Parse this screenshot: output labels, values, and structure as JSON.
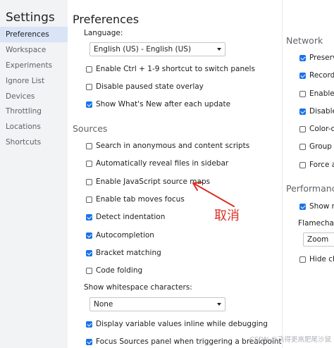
{
  "sidebar": {
    "title": "Settings",
    "items": [
      "Preferences",
      "Workspace",
      "Experiments",
      "Ignore List",
      "Devices",
      "Throttling",
      "Locations",
      "Shortcuts"
    ],
    "selected_index": 0
  },
  "main": {
    "title": "Preferences",
    "appearance": {
      "language_label": "Language:",
      "language_value": "English (US) - English (US)",
      "options": [
        {
          "label": "Enable Ctrl + 1-9 shortcut to switch panels",
          "checked": false
        },
        {
          "label": "Disable paused state overlay",
          "checked": false
        },
        {
          "label": "Show What's New after each update",
          "checked": true
        }
      ]
    },
    "sources": {
      "heading": "Sources",
      "options": [
        {
          "label": "Search in anonymous and content scripts",
          "checked": false
        },
        {
          "label": "Automatically reveal files in sidebar",
          "checked": false
        },
        {
          "label": "Enable JavaScript source maps",
          "checked": false
        },
        {
          "label": "Enable tab moves focus",
          "checked": false
        },
        {
          "label": "Detect indentation",
          "checked": true
        },
        {
          "label": "Autocompletion",
          "checked": true
        },
        {
          "label": "Bracket matching",
          "checked": true
        },
        {
          "label": "Code folding",
          "checked": false
        }
      ],
      "whitespace_label": "Show whitespace characters:",
      "whitespace_value": "None",
      "bottom_options": [
        {
          "label": "Display variable values inline while debugging",
          "checked": true
        },
        {
          "label": "Focus Sources panel when triggering a breakpoint",
          "checked": true
        }
      ]
    }
  },
  "right": {
    "network": {
      "heading": "Network",
      "options": [
        {
          "label": "Preserve",
          "checked": true
        },
        {
          "label": "Record",
          "checked": true
        },
        {
          "label": "Enable n",
          "checked": false
        },
        {
          "label": "Disable",
          "checked": true
        },
        {
          "label": "Color-co",
          "checked": false
        },
        {
          "label": "Group r",
          "checked": false
        },
        {
          "label": "Force ad",
          "checked": false
        }
      ]
    },
    "performance": {
      "heading": "Performance",
      "option": {
        "label": "Show na",
        "checked": true
      },
      "flamechart_label": "Flamechart",
      "flamechart_value": "Zoom",
      "hide_option": {
        "label": "Hide ch",
        "checked": false
      }
    }
  },
  "annotation": {
    "text": "取消",
    "color": "#d93025"
  },
  "watermark": "CSDN @飞得更高肥尾沙鼠",
  "colors": {
    "accent": "#1a73e8",
    "selected_bg": "#d9e4f7",
    "sidebar_bg": "#f1f3f4"
  }
}
